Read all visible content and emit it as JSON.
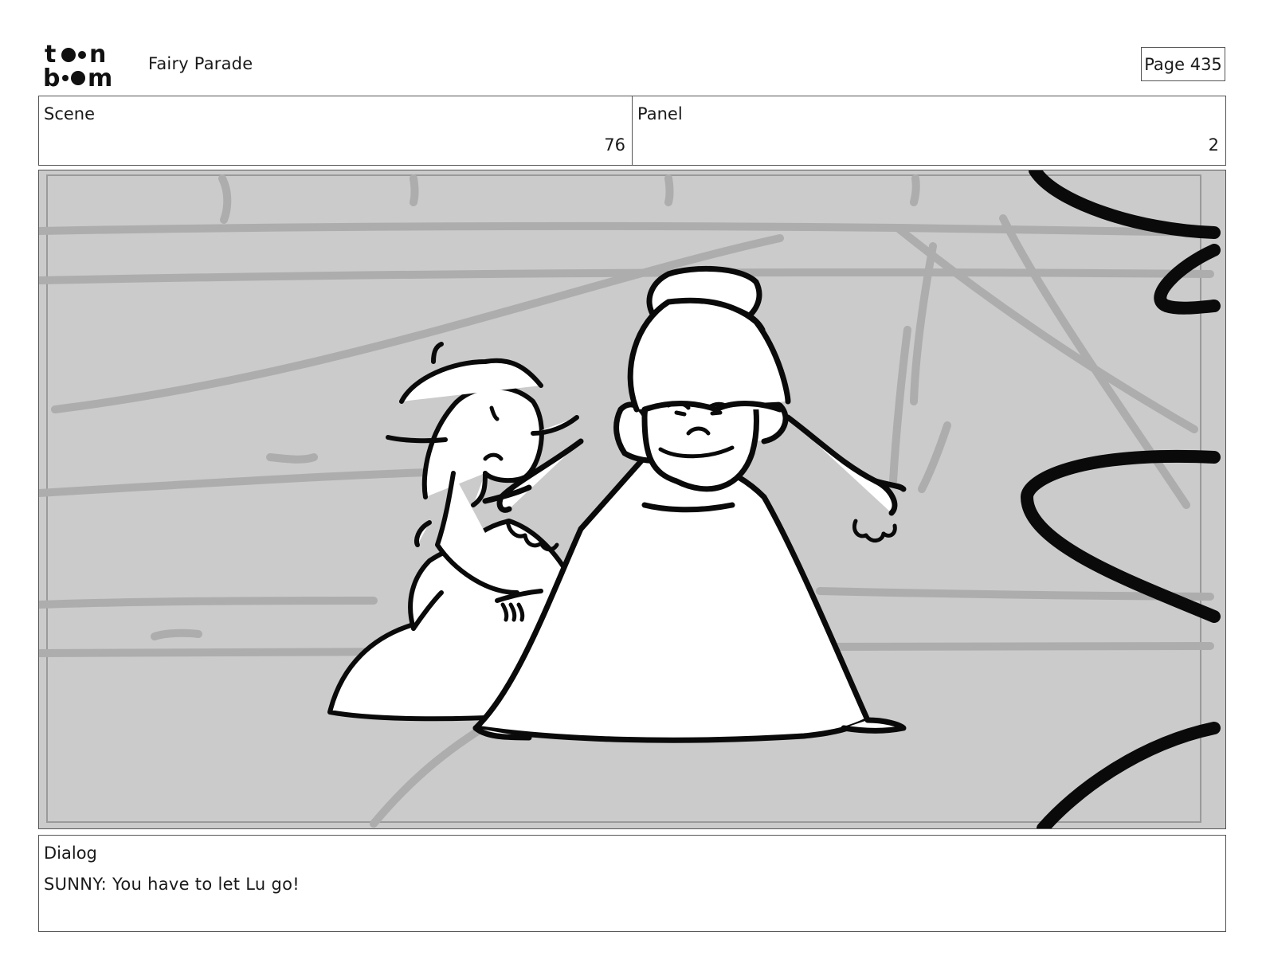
{
  "header": {
    "logo_text": "toonboom",
    "project_title": "Fairy Parade",
    "page_label": "Page 435"
  },
  "scene": {
    "label": "Scene",
    "value": "76"
  },
  "panel": {
    "label": "Panel",
    "value": "2"
  },
  "dialog": {
    "label": "Dialog",
    "text": "SUNNY: You have to let Lu go!"
  },
  "colors": {
    "background_gray": "#cbcbcb",
    "line_dark": "#0a0a0a",
    "line_light": "#a9a9a9"
  }
}
